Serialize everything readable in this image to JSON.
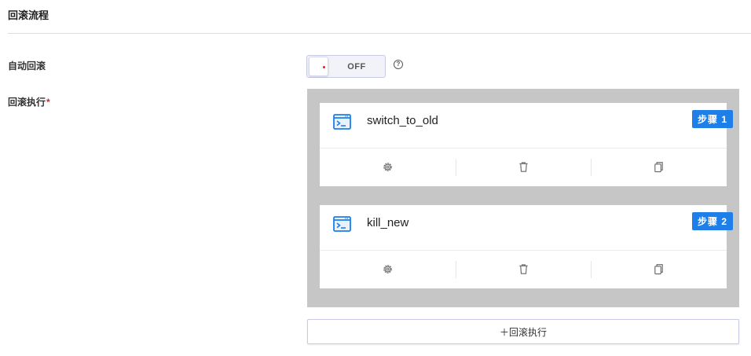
{
  "section": {
    "title": "回滚流程"
  },
  "auto_rollback": {
    "label": "自动回滚",
    "toggle_state": "OFF",
    "help_icon": "question-circle-icon"
  },
  "rollback_exec": {
    "label": "回滚执行",
    "required_mark": "*",
    "steps": [
      {
        "name": "switch_to_old",
        "badge": "步骤 1",
        "icon": "terminal-icon"
      },
      {
        "name": "kill_new",
        "badge": "步骤 2",
        "icon": "terminal-icon"
      }
    ],
    "step_actions": [
      "settings-icon",
      "trash-icon",
      "copy-icon"
    ],
    "add_button": "＋回滚执行"
  },
  "colors": {
    "accent": "#1e7fe8",
    "required": "#e02020",
    "steps_background": "#c6c6c6"
  }
}
